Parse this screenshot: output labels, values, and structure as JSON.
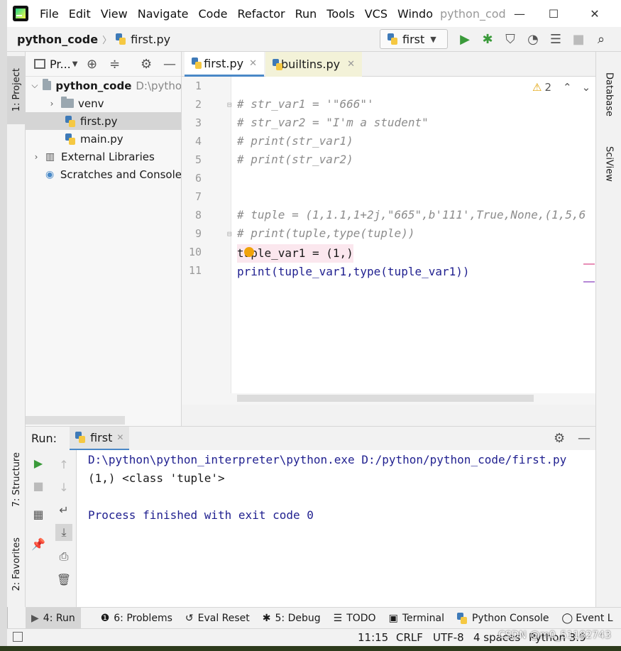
{
  "window": {
    "title": "python_cod",
    "menu": [
      "File",
      "Edit",
      "View",
      "Navigate",
      "Code",
      "Refactor",
      "Run",
      "Tools",
      "VCS",
      "Windo"
    ]
  },
  "navbar": {
    "project": "python_code",
    "file": "first.py",
    "run_config": "first"
  },
  "project_panel": {
    "title": "Pr...",
    "tree": [
      {
        "label": "python_code",
        "extra": "D:\\pytho",
        "type": "root"
      },
      {
        "label": "venv",
        "type": "folder"
      },
      {
        "label": "first.py",
        "type": "py"
      },
      {
        "label": "main.py",
        "type": "py"
      },
      {
        "label": "External Libraries",
        "type": "lib"
      },
      {
        "label": "Scratches and Console",
        "type": "scratch"
      }
    ]
  },
  "left_strip": {
    "project_tab": "1: Project",
    "structure_tab": "7: Structure",
    "favorites_tab": "2: Favorites"
  },
  "right_strip": {
    "database_tab": "Database",
    "sciview_tab": "SciView"
  },
  "editor": {
    "tabs": [
      "first.py",
      "builtins.py"
    ],
    "warnings": "2",
    "line_numbers": [
      "1",
      "2",
      "3",
      "4",
      "5",
      "6",
      "7",
      "8",
      "9",
      "10",
      "11"
    ],
    "lines": [
      "",
      "# str_var1 = '\"666\"'",
      "# str_var2 = \"I'm a student\"",
      "# print(str_var1)",
      "# print(str_var2)",
      "",
      "",
      "# tuple = (1,1.1,1+2j,\"665\",b'111',True,None,(1,5,6",
      "# print(tuple,type(tuple))",
      "tuple_var1 = (1,)",
      "print(tuple_var1,type(tuple_var1))"
    ]
  },
  "run_panel": {
    "label": "Run:",
    "tab": "first",
    "console": [
      "D:\\python\\python_interpreter\\python.exe D:/python/python_code/first.py",
      "(1,) <class 'tuple'>",
      "",
      "Process finished with exit code 0"
    ]
  },
  "bottom_tabs": [
    "4: Run",
    "6: Problems",
    "Eval Reset",
    "5: Debug",
    "TODO",
    "Terminal",
    "Python Console",
    "Event L"
  ],
  "status": {
    "position": "11:15",
    "line_sep": "CRLF",
    "encoding": "UTF-8",
    "indent": "4 spaces",
    "interpreter": "Python 3.9",
    "watermark": "CSDN @m0_51182743"
  },
  "colors": {
    "comment": "#8c8c8c",
    "number": "#1750eb",
    "console_text": "#1f1f8f",
    "run_green": "#3a9a3a"
  }
}
